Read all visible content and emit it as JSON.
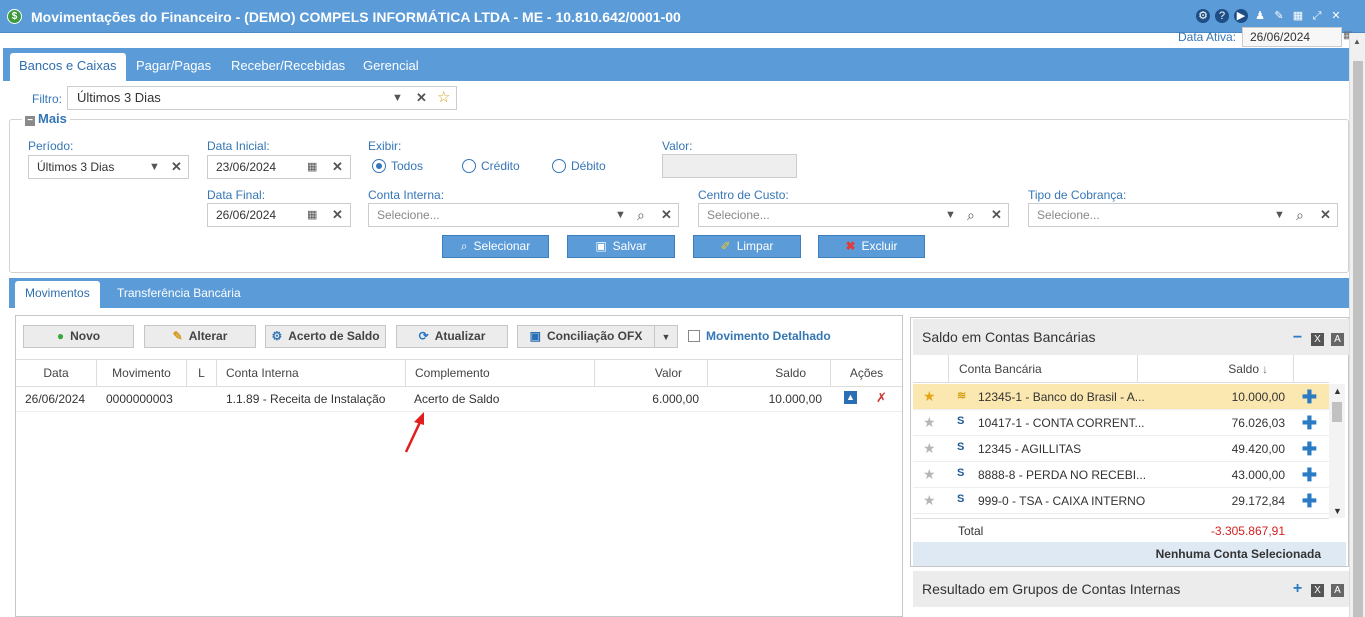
{
  "window": {
    "title": "Movimentações do Financeiro - (DEMO) COMPELS INFORMÁTICA LTDA - ME - 10.810.642/0001-00",
    "data_ativa_label": "Data Ativa:",
    "data_ativa_value": "26/06/2024"
  },
  "top_tabs": [
    "Bancos e Caixas",
    "Pagar/Pagas",
    "Receber/Recebidas",
    "Gerencial"
  ],
  "filtro": {
    "label": "Filtro:",
    "value": "Últimos 3 Dias"
  },
  "mais": {
    "legend": "Mais",
    "periodo_label": "Período:",
    "periodo_value": "Últimos 3 Dias",
    "data_inicial_label": "Data Inicial:",
    "data_inicial_value": "23/06/2024",
    "data_final_label": "Data Final:",
    "data_final_value": "26/06/2024",
    "exibir_label": "Exibir:",
    "exibir_options": [
      "Todos",
      "Crédito",
      "Débito"
    ],
    "exibir_selected": "Todos",
    "valor_label": "Valor:",
    "conta_interna_label": "Conta Interna:",
    "conta_interna_placeholder": "Selecione...",
    "centro_custo_label": "Centro de Custo:",
    "centro_custo_placeholder": "Selecione...",
    "tipo_cobranca_label": "Tipo de Cobrança:",
    "tipo_cobranca_placeholder": "Selecione..."
  },
  "actions": {
    "selecionar": "Selecionar",
    "salvar": "Salvar",
    "limpar": "Limpar",
    "excluir": "Excluir"
  },
  "mid_tabs": [
    "Movimentos",
    "Transferência Bancária"
  ],
  "toolbar": {
    "novo": "Novo",
    "alterar": "Alterar",
    "acerto": "Acerto de Saldo",
    "atualizar": "Atualizar",
    "conciliacao": "Conciliação OFX",
    "detalhado": "Movimento Detalhado"
  },
  "grid": {
    "headers": [
      "Data",
      "Movimento",
      "L",
      "Conta Interna",
      "Complemento",
      "Valor",
      "Saldo",
      "Ações"
    ],
    "rows": [
      {
        "data": "26/06/2024",
        "movimento": "0000000003",
        "l": "",
        "conta": "1.1.89 - Receita de Instalação",
        "complemento": "Acerto de Saldo",
        "valor": "6.000,00",
        "saldo": "10.000,00"
      }
    ]
  },
  "saldo_panel": {
    "title": "Saldo em Contas Bancárias",
    "header_conta": "Conta Bancária",
    "header_saldo": "Saldo",
    "rows": [
      {
        "name": "12345-1 - Banco do Brasil - A...",
        "value": "10.000,00",
        "favorite": true
      },
      {
        "name": "10417-1 - CONTA CORRENT...",
        "value": "76.026,03",
        "favorite": false
      },
      {
        "name": "12345 - AGILLITAS",
        "value": "49.420,00",
        "favorite": false
      },
      {
        "name": "8888-8 - PERDA NO RECEBI...",
        "value": "43.000,00",
        "favorite": false
      },
      {
        "name": "999-0 - TSA - CAIXA INTERNO",
        "value": "29.172,84",
        "favorite": false
      }
    ],
    "total_label": "Total",
    "total_value": "-3.305.867,91",
    "nenhuma": "Nenhuma Conta Selecionada"
  },
  "resultado_panel": {
    "title": "Resultado em Grupos de Contas Internas"
  },
  "colors": {
    "accent": "#5a9bd8",
    "label": "#3576b5",
    "negative": "#d42020",
    "selected_row": "#fbe8b0"
  }
}
